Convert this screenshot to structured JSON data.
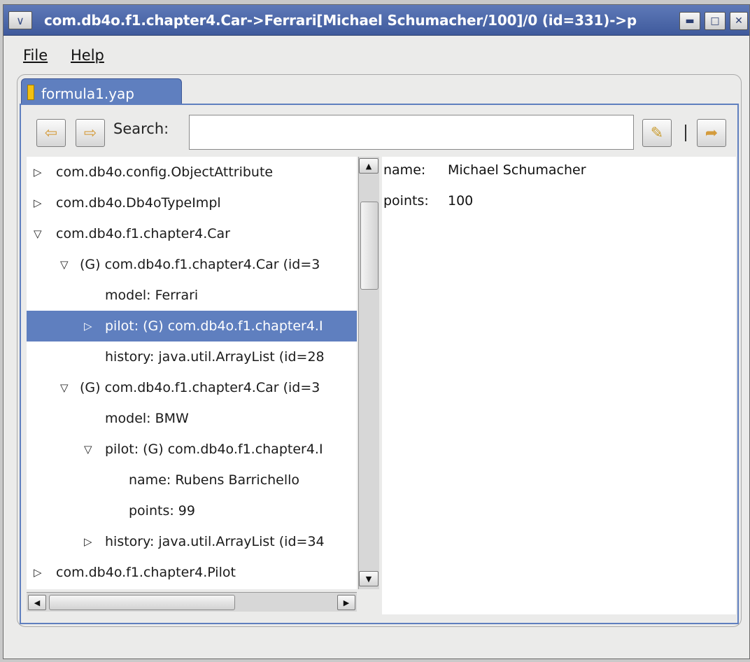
{
  "window": {
    "title": "com.db4o.f1.chapter4.Car->Ferrari[Michael Schumacher/100]/0 (id=331)->p",
    "sys_menu_icon": "chevron-down-icon",
    "minimize_icon": "minimize-icon",
    "maximize_icon": "maximize-icon",
    "close_icon": "close-icon"
  },
  "menubar": {
    "file": "File",
    "help": "Help"
  },
  "tab": {
    "label": "formula1.yap",
    "icon": "database-icon",
    "accent": "#5f7fbf"
  },
  "toolbar": {
    "back_icon": "arrow-left-icon",
    "forward_icon": "arrow-right-icon",
    "search_label": "Search:",
    "search_value": "",
    "search_button_icon": "flashlight-icon",
    "separator": "|",
    "export_icon": "export-icon"
  },
  "tree": {
    "rows": [
      {
        "text": "com.db4o.config.ObjectAttribute",
        "expander": "collapsed",
        "level": 0,
        "selected": false
      },
      {
        "text": "com.db4o.Db4oTypeImpl",
        "expander": "collapsed",
        "level": 0,
        "selected": false
      },
      {
        "text": "com.db4o.f1.chapter4.Car",
        "expander": "expanded",
        "level": 0,
        "selected": false
      },
      {
        "text": "(G) com.db4o.f1.chapter4.Car (id=3",
        "expander": "expanded",
        "level": 1,
        "selected": false
      },
      {
        "text": "model: Ferrari",
        "expander": "none",
        "level": 2,
        "selected": false
      },
      {
        "text": "pilot: (G) com.db4o.f1.chapter4.I",
        "expander": "collapsed",
        "level": 2,
        "selected": true
      },
      {
        "text": "history: java.util.ArrayList (id=28",
        "expander": "none",
        "level": 2,
        "selected": false
      },
      {
        "text": "(G) com.db4o.f1.chapter4.Car (id=3",
        "expander": "expanded",
        "level": 1,
        "selected": false
      },
      {
        "text": "model: BMW",
        "expander": "none",
        "level": 2,
        "selected": false
      },
      {
        "text": "pilot: (G) com.db4o.f1.chapter4.I",
        "expander": "expanded",
        "level": 2,
        "selected": false
      },
      {
        "text": "name: Rubens Barrichello",
        "expander": "none",
        "level": 3,
        "selected": false
      },
      {
        "text": "points: 99",
        "expander": "none",
        "level": 3,
        "selected": false
      },
      {
        "text": "history: java.util.ArrayList (id=34",
        "expander": "collapsed",
        "level": 2,
        "selected": false
      },
      {
        "text": "com.db4o.f1.chapter4.Pilot",
        "expander": "collapsed",
        "level": 0,
        "selected": false
      }
    ]
  },
  "detail": {
    "fields": [
      {
        "key": "name:",
        "value": "Michael Schumacher"
      },
      {
        "key": "points:",
        "value": "100"
      }
    ]
  },
  "scroll": {
    "up_icon": "arrow-up-icon",
    "down_icon": "arrow-down-icon",
    "left_icon": "arrow-left-icon",
    "right_icon": "arrow-right-icon"
  }
}
